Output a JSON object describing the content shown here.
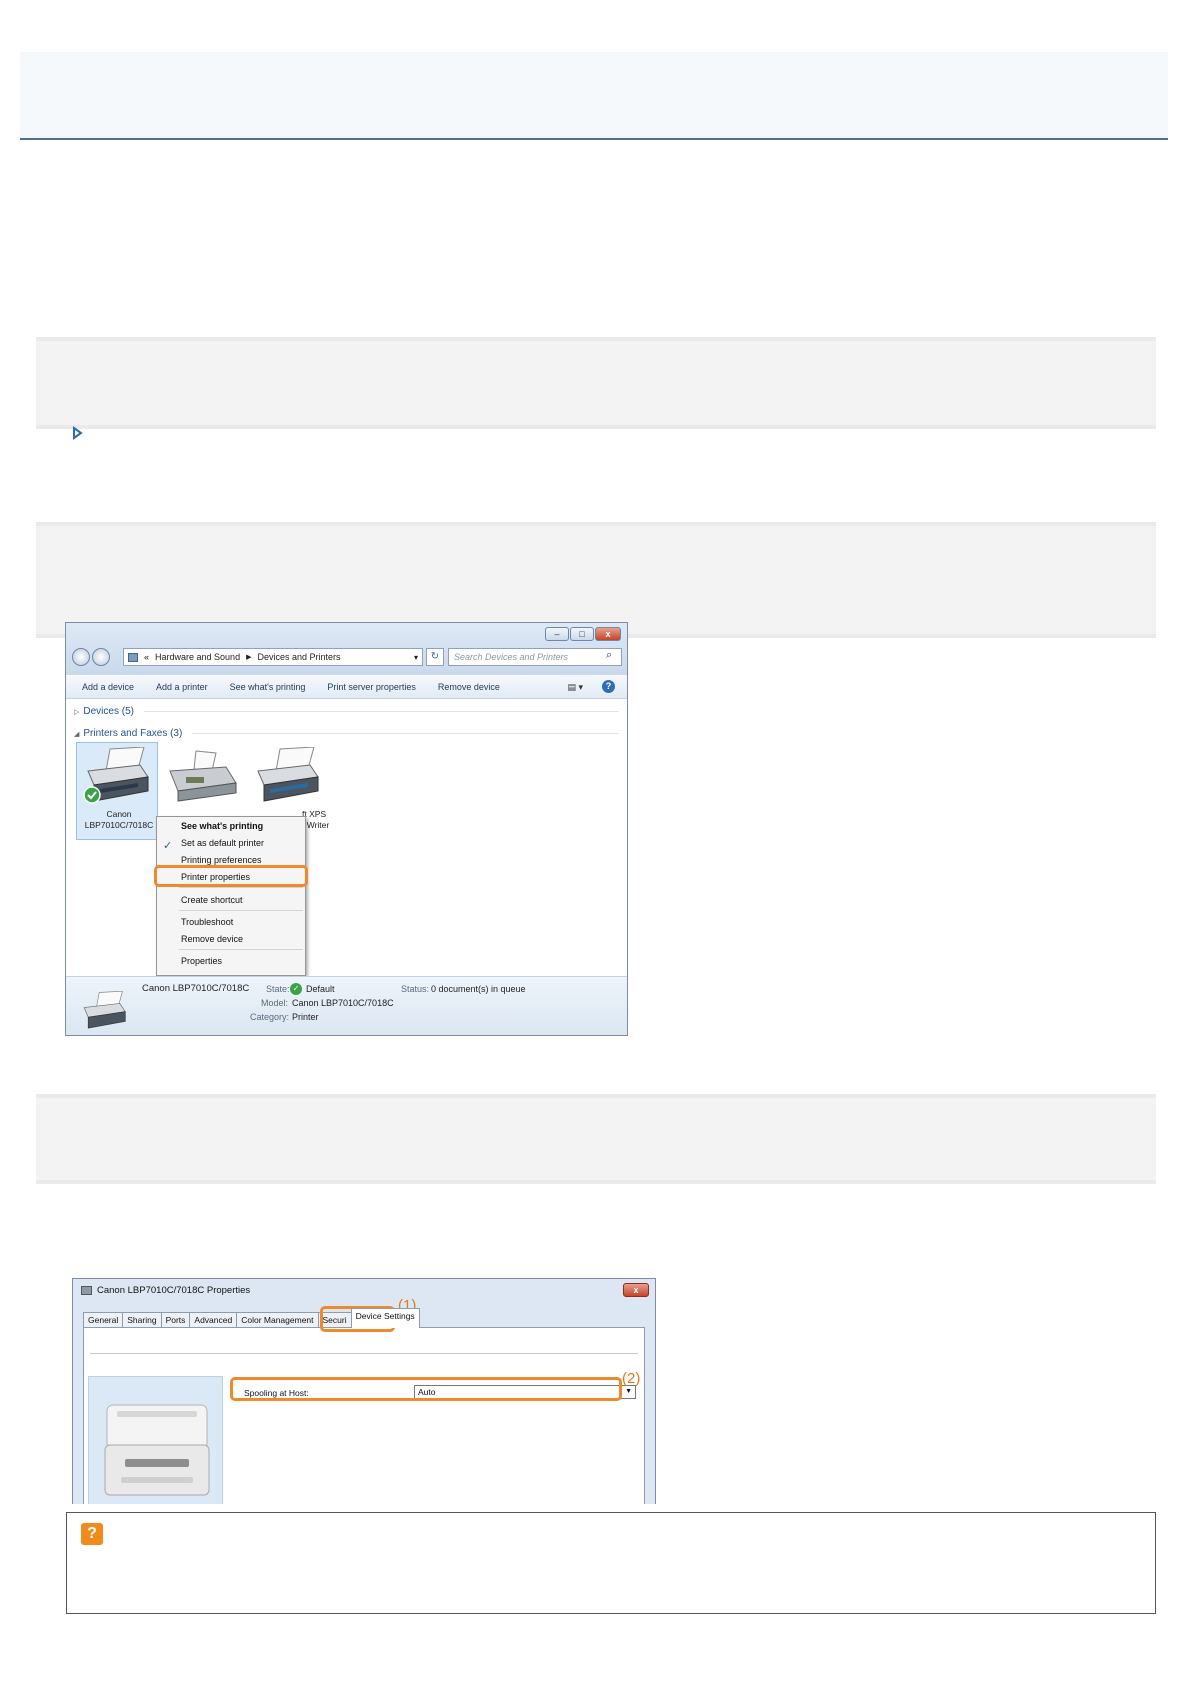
{
  "explorer": {
    "window_buttons": [
      "–",
      "□",
      "x"
    ],
    "breadcrumb": [
      "«",
      "Hardware and Sound",
      "Devices and Printers"
    ],
    "address_dropdown": "▾",
    "refresh_glyph": "↻",
    "search_placeholder": "Search Devices and Printers",
    "toolbar": [
      "Add a device",
      "Add a printer",
      "See what's printing",
      "Print server properties",
      "Remove device"
    ],
    "groups": {
      "devices": "Devices (5)",
      "printers": "Printers and Faxes (3)"
    },
    "printers": [
      {
        "label_line1": "Canon",
        "label_line2": "LBP7010C/7018C"
      },
      {
        "label_line1": "ft XPS",
        "label_line2": "t Writer"
      }
    ],
    "context_menu": [
      "See what's printing",
      "Set as default printer",
      "Printing preferences",
      "Printer properties",
      "Create shortcut",
      "Troubleshoot",
      "Remove device",
      "Properties"
    ],
    "details": {
      "name": "Canon LBP7010C/7018C",
      "state_key": "State:",
      "state_val": "Default",
      "status_key": "Status:",
      "status_val": "0 document(s) in queue",
      "model_key": "Model:",
      "model_val": "Canon LBP7010C/7018C",
      "category_key": "Category:",
      "category_val": "Printer"
    }
  },
  "properties": {
    "title": "Canon LBP7010C/7018C Properties",
    "close": "x",
    "tabs": [
      "General",
      "Sharing",
      "Ports",
      "Advanced",
      "Color Management",
      "Securi",
      "Device Settings"
    ],
    "callout1": "(1)",
    "callout2": "(2)",
    "spool_label": "Spooling at Host:",
    "spool_value": "Auto"
  },
  "hint_icon": "?",
  "colors": {
    "highlight": "#ee8a2a",
    "title_rule": "#4d7189",
    "hint_icon": "#ef8c1b"
  }
}
